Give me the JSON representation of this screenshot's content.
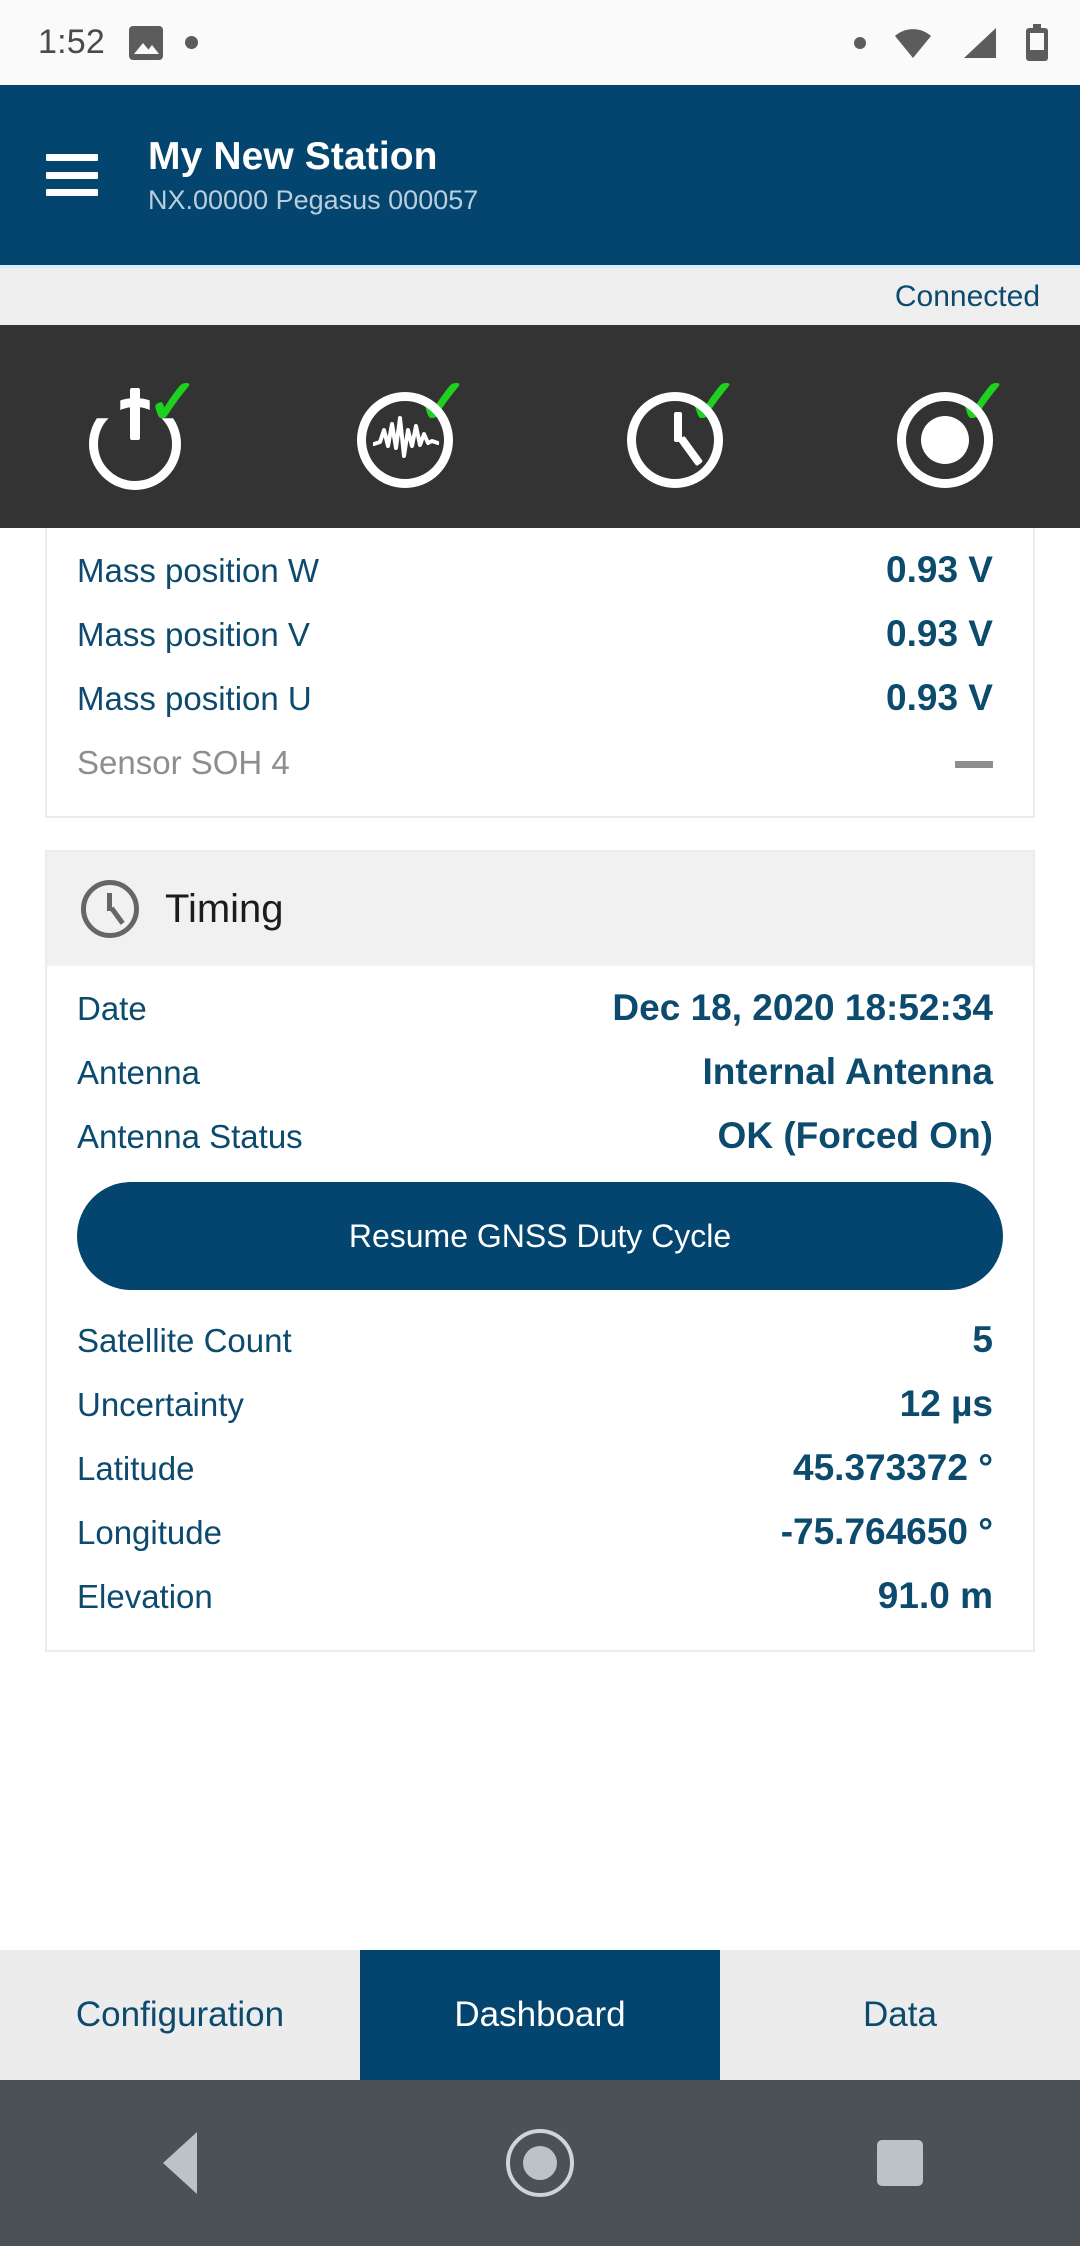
{
  "statusbar": {
    "time": "1:52",
    "icons": [
      "gallery-icon",
      "notification-dot-icon",
      "small-dot-icon",
      "wifi-icon",
      "cellular-signal-icon",
      "battery-icon"
    ]
  },
  "header": {
    "menu_icon": "hamburger-menu-icon",
    "title": "My New Station",
    "subtitle": "NX.00000  Pegasus 000057"
  },
  "connection": {
    "status": "Connected"
  },
  "status_panel": {
    "items": [
      {
        "icon": "power-icon",
        "state": "ok",
        "check": "✓"
      },
      {
        "icon": "seismic-waveform-icon",
        "state": "ok",
        "check": "✓"
      },
      {
        "icon": "clock-timing-icon",
        "state": "ok",
        "check": "✓"
      },
      {
        "icon": "recording-icon",
        "state": "ok",
        "check": "✓"
      }
    ]
  },
  "sensor_card": {
    "rows": [
      {
        "label": "Mass position W",
        "value": "0.93 V"
      },
      {
        "label": "Mass position V",
        "value": "0.93 V"
      },
      {
        "label": "Mass position U",
        "value": "0.93 V"
      },
      {
        "label": "Sensor SOH 4",
        "value": "—"
      }
    ]
  },
  "timing_card": {
    "icon": "clock-icon",
    "title": "Timing",
    "top_rows": [
      {
        "label": "Date",
        "value": "Dec 18, 2020 18:52:34"
      },
      {
        "label": "Antenna",
        "value": "Internal Antenna"
      },
      {
        "label": "Antenna Status",
        "value": "OK (Forced On)"
      }
    ],
    "button_label": "Resume GNSS Duty Cycle",
    "bottom_rows": [
      {
        "label": "Satellite Count",
        "value": "5"
      },
      {
        "label": "Uncertainty",
        "value": "12 µs"
      },
      {
        "label": "Latitude",
        "value": "45.373372 °"
      },
      {
        "label": "Longitude",
        "value": "-75.764650 °"
      },
      {
        "label": "Elevation",
        "value": "91.0 m"
      }
    ]
  },
  "tabs": [
    {
      "label": "Configuration",
      "active": false
    },
    {
      "label": "Dashboard",
      "active": true
    },
    {
      "label": "Data",
      "active": false
    }
  ],
  "navbar": {
    "back": "back-icon",
    "home": "home-icon",
    "recents": "recents-icon"
  },
  "colors": {
    "brand": "#03456e",
    "accent_text": "#0c4a6e",
    "check_green": "#1fd11f",
    "panel_dark": "#333333",
    "muted": "#8e8e8e"
  }
}
